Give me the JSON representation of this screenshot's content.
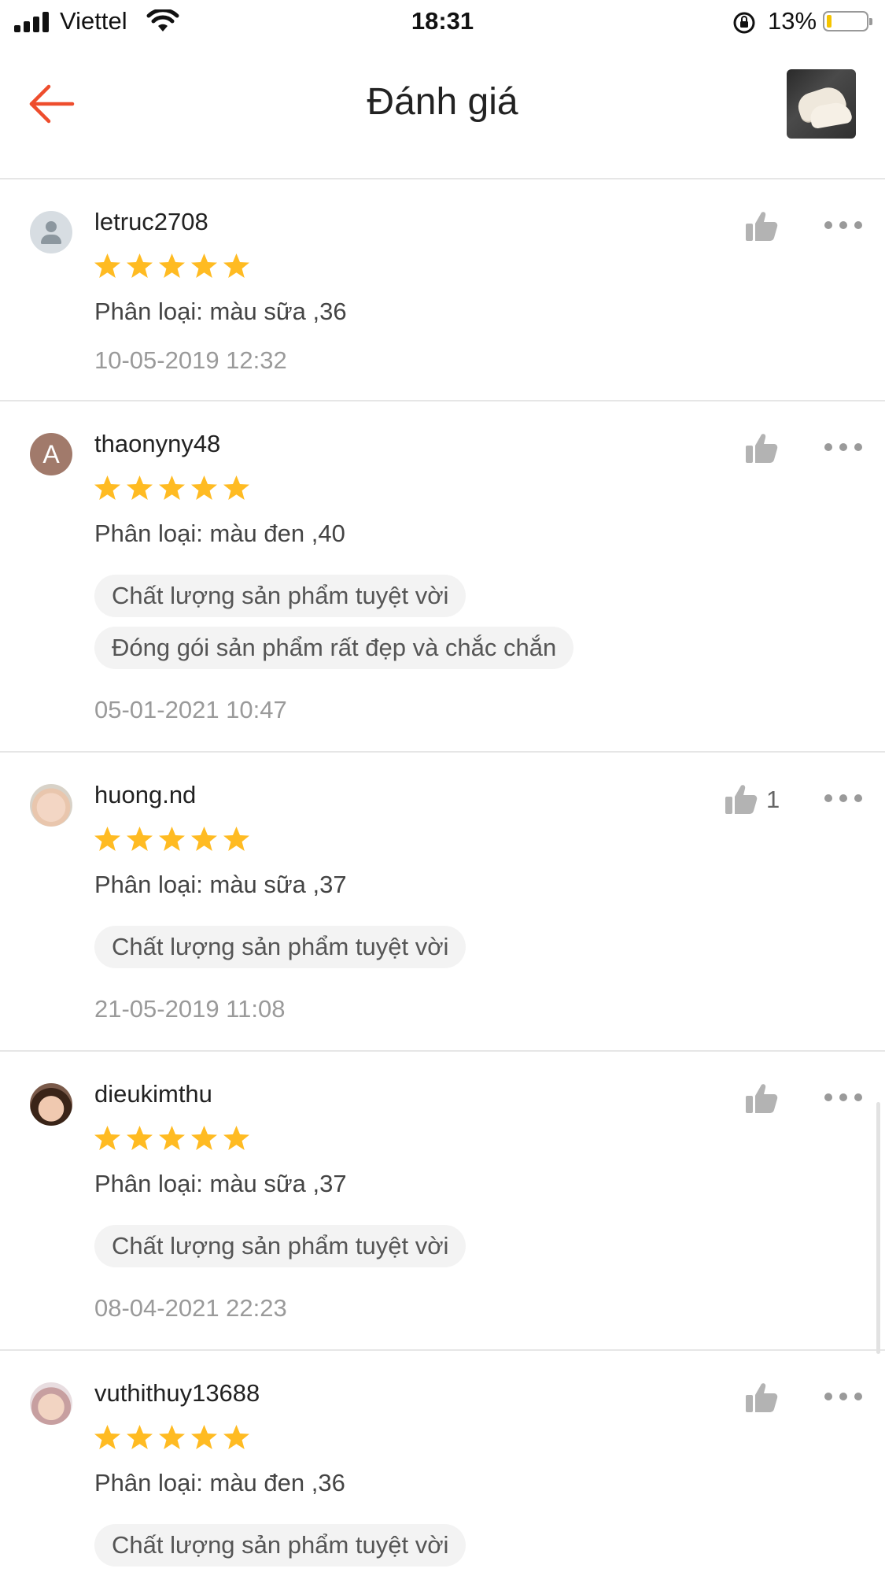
{
  "status_bar": {
    "carrier": "Viettel",
    "time": "18:31",
    "battery_percent": "13%",
    "battery_level": 0.13,
    "icons": [
      "signal-icon",
      "wifi-icon",
      "rotation-lock-icon",
      "battery-icon"
    ]
  },
  "header": {
    "title": "Đánh giá",
    "back_icon": "arrow-left-icon",
    "accent_color": "#ee4d2d"
  },
  "reviews": [
    {
      "username": "letruc2708",
      "avatar": "default",
      "rating": 5,
      "variant": "Phân loại: màu sữa ,36",
      "tags": [],
      "date": "10-05-2019 12:32",
      "likes": ""
    },
    {
      "username": "thaonyny48",
      "avatar": "A",
      "rating": 5,
      "variant": "Phân loại: màu đen ,40",
      "tags": [
        "Chất lượng sản phẩm tuyệt vời",
        "Đóng gói sản phẩm rất đẹp và chắc chắn"
      ],
      "date": "05-01-2021 10:47",
      "likes": ""
    },
    {
      "username": "huong.nd",
      "avatar": "photo",
      "rating": 5,
      "variant": "Phân loại: màu sữa ,37",
      "tags": [
        "Chất lượng sản phẩm tuyệt vời"
      ],
      "date": "21-05-2019 11:08",
      "likes": "1"
    },
    {
      "username": "dieukimthu",
      "avatar": "photo",
      "rating": 5,
      "variant": "Phân loại: màu sữa ,37",
      "tags": [
        "Chất lượng sản phẩm tuyệt vời"
      ],
      "date": "08-04-2021 22:23",
      "likes": ""
    },
    {
      "username": "vuthithuy13688",
      "avatar": "photo",
      "rating": 5,
      "variant": "Phân loại: màu đen ,36",
      "tags": [
        "Chất lượng sản phẩm tuyệt vời"
      ],
      "date": "",
      "likes": ""
    }
  ],
  "star_color": "#ffbb22",
  "icons": {
    "like": "thumbs-up-icon",
    "more": "more-dots-icon",
    "star": "star-icon"
  }
}
